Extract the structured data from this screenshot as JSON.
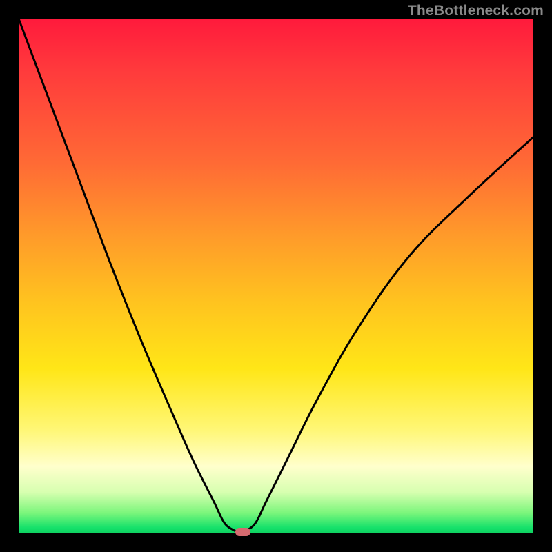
{
  "watermark": "TheBottleneck.com",
  "chart_data": {
    "type": "line",
    "title": "",
    "xlabel": "",
    "ylabel": "",
    "xlim": [
      0,
      100
    ],
    "ylim": [
      0,
      100
    ],
    "grid": false,
    "series": [
      {
        "name": "bottleneck-curve",
        "x": [
          0,
          6,
          12,
          18,
          24,
          30,
          34,
          38,
          40,
          42,
          43,
          44,
          46,
          48,
          52,
          58,
          66,
          76,
          88,
          100
        ],
        "y": [
          100,
          84,
          68,
          52,
          37,
          23,
          14,
          6,
          2,
          0.5,
          0,
          0.4,
          2,
          6,
          14,
          26,
          40,
          54,
          66,
          77
        ]
      }
    ],
    "marker": {
      "x": 43.5,
      "y": 0,
      "label": "optimal-point"
    },
    "gradient_stops": [
      {
        "pos": 0,
        "color": "#ff1a3c"
      },
      {
        "pos": 28,
        "color": "#ff6a35"
      },
      {
        "pos": 55,
        "color": "#ffc31f"
      },
      {
        "pos": 80,
        "color": "#fff777"
      },
      {
        "pos": 92,
        "color": "#d7ffb0"
      },
      {
        "pos": 100,
        "color": "#0fd060"
      }
    ]
  }
}
